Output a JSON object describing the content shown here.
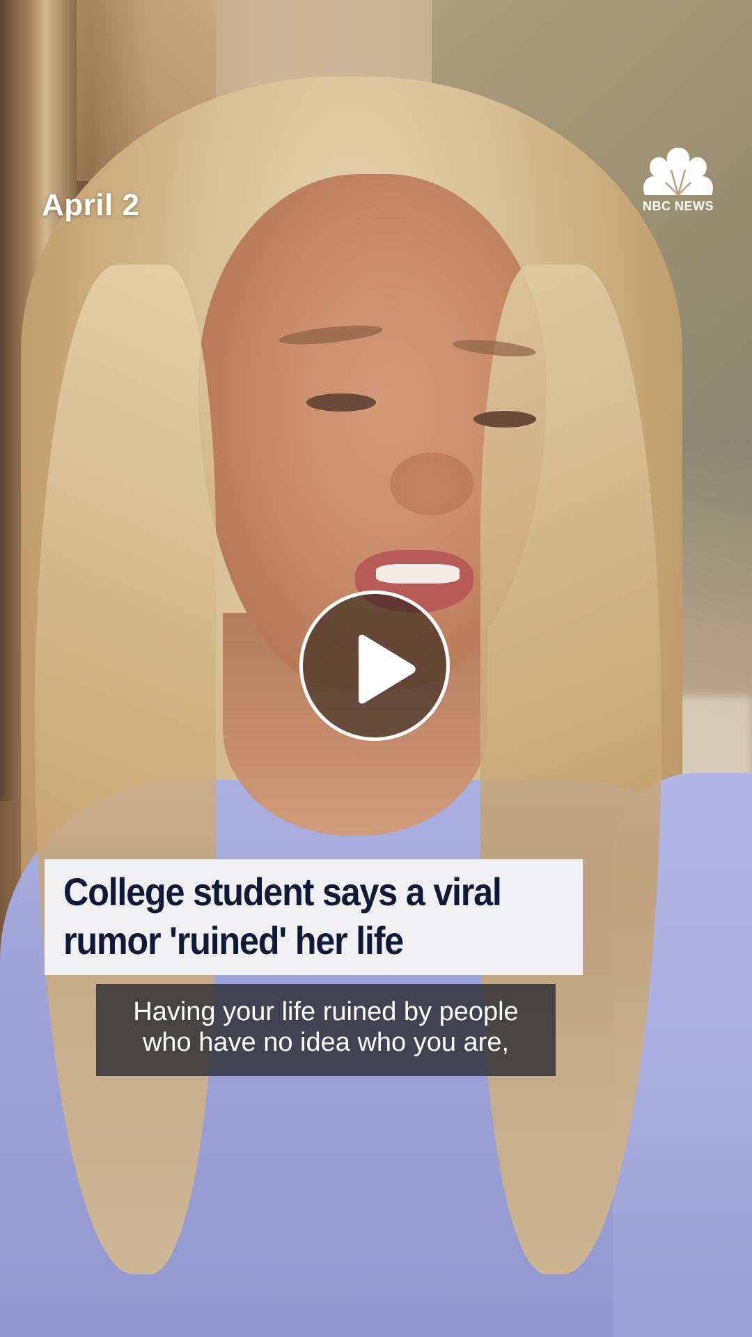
{
  "video": {
    "date_label": "April 2",
    "brand": {
      "logo_icon": "nbc-peacock-icon",
      "name": "NBC NEWS"
    },
    "play_icon": "play-icon",
    "headline_line1": "College student says a viral",
    "headline_line2": "rumor 'ruined' her life",
    "caption_line1": "Having your life ruined by people",
    "caption_line2": "who have no idea who you are,"
  },
  "colors": {
    "headline_text": "#0e1a36",
    "headline_bg": "#f0f0f2",
    "caption_bg": "#2d2d34",
    "overlay_text": "#ffffff"
  }
}
